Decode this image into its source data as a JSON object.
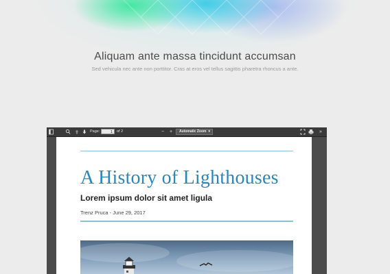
{
  "hero": {
    "title": "Aliquam ante massa tincidunt accumsan",
    "subtitle": "Sed vehicula nec ante non porttitor. Cras at eros vel tellus sagittis pharetra rhoncus a ante."
  },
  "toolbar": {
    "page_label": "Page:",
    "page_value": "1",
    "page_total": "of 2",
    "zoom_out": "−",
    "zoom_in": "+",
    "zoom_value": "Automatic Zoom",
    "more": "»"
  },
  "document": {
    "title": "A History of Lighthouses",
    "subtitle": "Lorem ipsum dolor sit amet ligula",
    "byline": "Trenz Pruca - June 29, 2017"
  },
  "colors": {
    "accent": "#2a86b4",
    "rule": "#8ec1d8",
    "viewer_bg": "#4b4b4b",
    "toolbar_bg": "#3a3a3a"
  }
}
